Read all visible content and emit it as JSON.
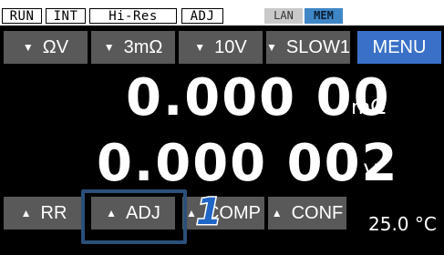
{
  "status_bar": {
    "run": "RUN",
    "int": "INT",
    "mode": "Hi-Res",
    "adj": "ADJ",
    "lan": "LAN",
    "mem": "MEM"
  },
  "top_buttons": {
    "range_resistance": "ΩV",
    "range_value": "3mΩ",
    "range_voltage": "10V",
    "speed": "SLOW1",
    "menu": "MENU"
  },
  "readings": {
    "resistance_value": "0.000 00",
    "resistance_unit": "mΩ",
    "voltage_value": "0.000 002",
    "voltage_unit": "V"
  },
  "bottom_buttons": {
    "rr": "RR",
    "adj": "ADJ",
    "comp": "COMP",
    "conf": "CONF"
  },
  "temperature": "25.0 °C",
  "callout_number": "1",
  "colors": {
    "screen_bg": "#000000",
    "button_bg": "#595959",
    "menu_bg": "#3a70c8",
    "highlight_border": "#2a4f7a",
    "callout_fill": "#1f66c7"
  },
  "icons": {
    "dropdown": "triangle-down-icon",
    "popup": "triangle-up-icon"
  }
}
